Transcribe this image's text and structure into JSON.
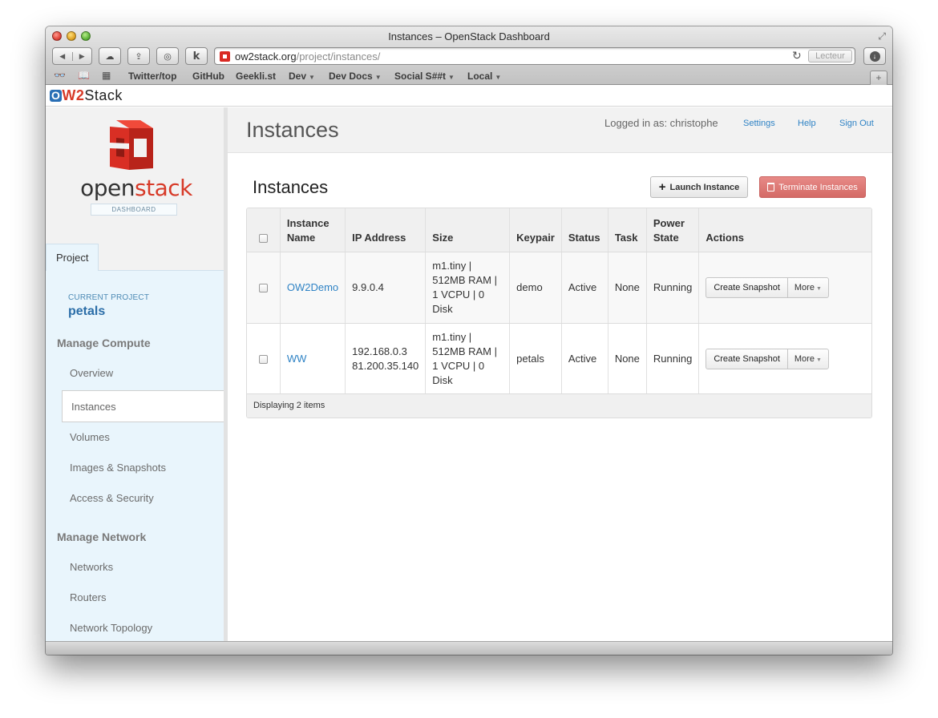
{
  "window": {
    "title": "Instances – OpenStack Dashboard"
  },
  "toolbar": {
    "url_host": "ow2stack.org",
    "url_path": "/project/instances/",
    "reader_label": "Lecteur",
    "k_label": "k"
  },
  "bookmarks": [
    {
      "label": "Twitter/top",
      "dropdown": false
    },
    {
      "label": "GitHub",
      "dropdown": false
    },
    {
      "label": "Geekli.st",
      "dropdown": false
    },
    {
      "label": "Dev",
      "dropdown": true
    },
    {
      "label": "Dev Docs",
      "dropdown": true
    },
    {
      "label": "Social S##t",
      "dropdown": true
    },
    {
      "label": "Local",
      "dropdown": true
    }
  ],
  "brand": {
    "o": "O",
    "w2": "W2",
    "stack": "Stack"
  },
  "sidebar": {
    "logo_open": "open",
    "logo_stack": "stack",
    "logo_sub": "DASHBOARD",
    "tab": "Project",
    "current_project_label": "CURRENT PROJECT",
    "current_project": "petals",
    "sections": [
      {
        "title": "Manage Compute",
        "items": [
          "Overview",
          "Instances",
          "Volumes",
          "Images & Snapshots",
          "Access & Security"
        ]
      },
      {
        "title": "Manage Network",
        "items": [
          "Networks",
          "Routers",
          "Network Topology"
        ]
      }
    ],
    "active_item": "Instances"
  },
  "header": {
    "title": "Instances",
    "logged_in": "Logged in as: christophe",
    "links": [
      "Settings",
      "Help",
      "Sign Out"
    ]
  },
  "main": {
    "section_title": "Instances",
    "launch_label": "Launch Instance",
    "terminate_label": "Terminate Instances",
    "columns": [
      "Instance Name",
      "IP Address",
      "Size",
      "Keypair",
      "Status",
      "Task",
      "Power State",
      "Actions"
    ],
    "rows": [
      {
        "name": "OW2Demo",
        "ip": [
          "9.9.0.4"
        ],
        "size": [
          "m1.tiny |",
          "512MB RAM |",
          "1 VCPU | 0",
          "Disk"
        ],
        "keypair": "demo",
        "status": "Active",
        "task": "None",
        "power": "Running",
        "action": "Create Snapshot",
        "more": "More"
      },
      {
        "name": "WW",
        "ip": [
          "192.168.0.3",
          "81.200.35.140"
        ],
        "size": [
          "m1.tiny |",
          "512MB RAM |",
          "1 VCPU | 0",
          "Disk"
        ],
        "keypair": "petals",
        "status": "Active",
        "task": "None",
        "power": "Running",
        "action": "Create Snapshot",
        "more": "More"
      }
    ],
    "footer": "Displaying 2 items"
  },
  "colors": {
    "accent": "#2f83c5",
    "brand_red": "#d73a28",
    "terminate": "#d46a66",
    "nav_bg": "#e9f5fc"
  }
}
